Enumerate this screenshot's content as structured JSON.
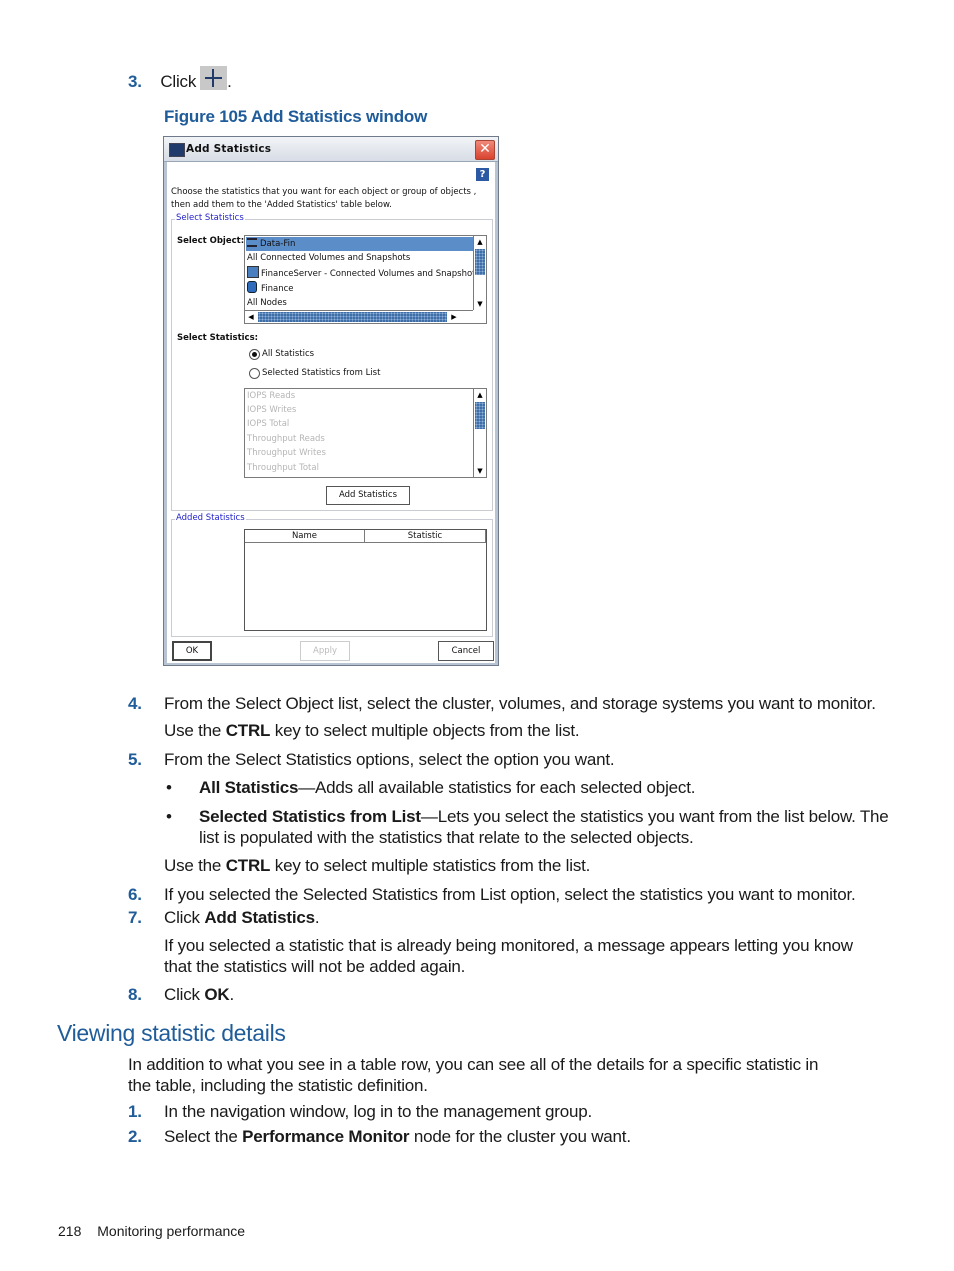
{
  "steps_top": {
    "step3": {
      "number": "3.",
      "text": "Click",
      "icon": "plus-icon",
      "suffix": "."
    }
  },
  "figure": {
    "caption": "Figure 105 Add Statistics window"
  },
  "dialog": {
    "title": "Add Statistics",
    "close_icon": "close-icon",
    "help_icon": "?",
    "intro_line1": "Choose the statistics that you want for each object or group of objects ,",
    "intro_line2": "then add them to the 'Added Statistics' table below.",
    "select_group_label": "Select Statistics",
    "select_object_label": "Select Object:",
    "objects": [
      {
        "label": "Data-Fin",
        "icon": "cluster-icon",
        "selected": true
      },
      {
        "label": "All Connected Volumes and Snapshots",
        "icon": "",
        "selected": false
      },
      {
        "label": "FinanceServer - Connected Volumes and Snapshots",
        "icon": "server-icon",
        "selected": false
      },
      {
        "label": "Finance",
        "icon": "volume-icon",
        "selected": false
      },
      {
        "label": "All Nodes",
        "icon": "",
        "selected": false
      }
    ],
    "select_statistics_label": "Select Statistics:",
    "radio_all": "All Statistics",
    "radio_selected": "Selected Statistics from List",
    "radio_selected_value": "All Statistics",
    "statistics": [
      "IOPS Reads",
      "IOPS Writes",
      "IOPS Total",
      "Throughput Reads",
      "Throughput Writes",
      "Throughput Total"
    ],
    "add_button": "Add Statistics",
    "added_group_label": "Added Statistics",
    "table_columns": [
      "Name",
      "Statistic"
    ],
    "ok_button": "OK",
    "apply_button": "Apply",
    "cancel_button": "Cancel"
  },
  "steps": {
    "s4": {
      "number": "4.",
      "text": "From the Select Object list, select the cluster, volumes, and storage systems you want to monitor."
    },
    "s4_note": {
      "pre": "Use the ",
      "bold": "CTRL",
      "post": " key to select multiple objects from the list."
    },
    "s5": {
      "number": "5.",
      "text": "From the Select Statistics options, select the option you want."
    },
    "bullet1": {
      "bold": "All Statistics",
      "text": "—Adds all available statistics for each selected object."
    },
    "bullet2": {
      "bold": "Selected Statistics from List",
      "text_line1": "—Lets you select the statistics you want from the list below. The",
      "text_line2": "list is populated with the statistics that relate to the selected objects."
    },
    "s5_note": {
      "pre": "Use the ",
      "bold": "CTRL",
      "post": " key to select multiple statistics from the list."
    },
    "s6": {
      "number": "6.",
      "text": "If you selected the Selected Statistics from List option, select the statistics you want to monitor."
    },
    "s7": {
      "number": "7.",
      "pre": "Click ",
      "bold": "Add Statistics",
      "post": "."
    },
    "s7_note_line1": "If you selected a statistic that is already being monitored, a message appears letting you know",
    "s7_note_line2": "that the statistics will not be added again.",
    "s8": {
      "number": "8.",
      "pre": "Click ",
      "bold": "OK",
      "post": "."
    }
  },
  "section": {
    "heading": "Viewing statistic details",
    "intro_line1": "In addition to what you see in a table row, you can see all of the details for a specific statistic in",
    "intro_line2": "the table, including the statistic definition.",
    "s1": {
      "number": "1.",
      "text": "In the navigation window, log in to the management group."
    },
    "s2": {
      "number": "2.",
      "pre": "Select the ",
      "bold": "Performance Monitor",
      "post": " node for the cluster you want."
    }
  },
  "footer": {
    "page_number": "218",
    "chapter": "Monitoring performance"
  }
}
